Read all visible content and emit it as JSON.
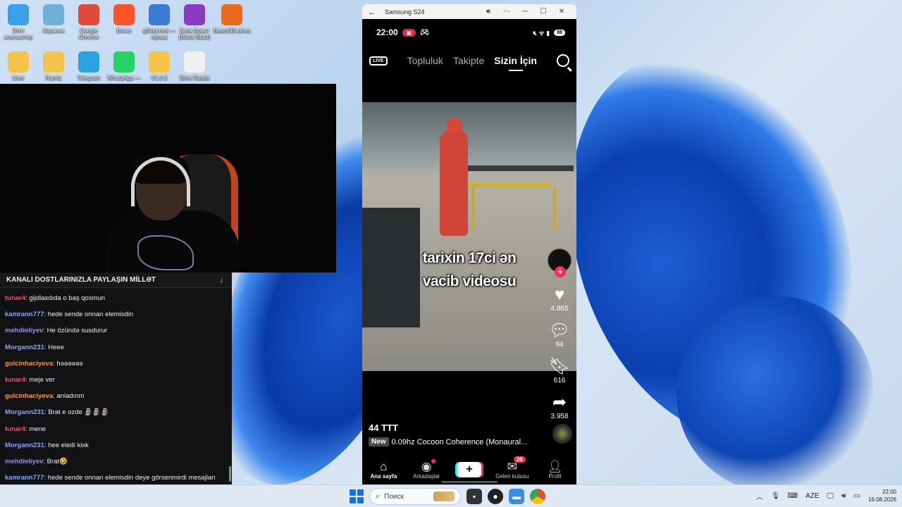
{
  "desktop_icons": [
    {
      "label": "Этот компьютер",
      "icon": "monitor-icon",
      "color": "#3aa0e8"
    },
    {
      "label": "Корзина",
      "icon": "recycle-bin-icon",
      "color": "#6fb0d8"
    },
    {
      "label": "Google Chrome",
      "icon": "chrome-icon",
      "color": "#e04a3a"
    },
    {
      "label": "Brave",
      "icon": "brave-icon",
      "color": "#fb542b"
    },
    {
      "label": "qBittorrent — ярлык",
      "icon": "qbittorrent-icon",
      "color": "#3a7bd5"
    },
    {
      "label": "Блок Бласт (Block Blast)",
      "icon": "block-blast-icon",
      "color": "#8a3ac0"
    },
    {
      "label": "BeamNG.drive",
      "icon": "beamng-icon",
      "color": "#e86a1c"
    },
    {
      "label": "User",
      "icon": "folder-icon",
      "color": "#f3c34a"
    },
    {
      "label": "Ramiz",
      "icon": "folder-icon",
      "color": "#f3c34a"
    },
    {
      "label": "Telegram",
      "icon": "telegram-icon",
      "color": "#2aa3e0"
    },
    {
      "label": "WhatsApp —",
      "icon": "whatsapp-icon",
      "color": "#25d366"
    },
    {
      "label": "V1.0.5",
      "icon": "folder-zip-icon",
      "color": "#f3c34a"
    },
    {
      "label": "Slow Roads",
      "icon": "slow-roads-icon",
      "color": "#f0f0f0"
    }
  ],
  "chat": {
    "header": "KANALI DOSTLARINIZLA PAYLAŞIN MİLLƏT",
    "messages": [
      {
        "user": "tunar4",
        "color": "#ff4d6d",
        "text": ": gijdlaxdıda o baş qosmun"
      },
      {
        "user": "kamrann777",
        "color": "#8aa8ff",
        "text": ": hede sende onnan elemisdin"
      },
      {
        "user": "mehdieliyev",
        "color": "#9b8cff",
        "text": ": He özündə susdurur"
      },
      {
        "user": "Morgann231",
        "color": "#8aa8ff",
        "text": ": Heee"
      },
      {
        "user": "gulcinhaciyeva",
        "color": "#ff9a3c",
        "text": ": həəəəəə"
      },
      {
        "user": "tunar4",
        "color": "#ff4d6d",
        "text": ": meje ver"
      },
      {
        "user": "gulcinhaciyeva",
        "color": "#ff9a3c",
        "text": ": anladınm"
      },
      {
        "user": "Morgann231",
        "color": "#8aa8ff",
        "text": ": Brat e ozde 🗿🗿🗿"
      },
      {
        "user": "tunar4",
        "color": "#ff4d6d",
        "text": ": mene"
      },
      {
        "user": "Morgann231",
        "color": "#8aa8ff",
        "text": ": hee eledi kixk"
      },
      {
        "user": "mehdieliyev",
        "color": "#9b8cff",
        "text": ": Brat🤣"
      },
      {
        "user": "kamrann777",
        "color": "#8aa8ff",
        "text": ": hede sende onnan elemisdin deye görsenmirdi mesajları"
      }
    ]
  },
  "phone": {
    "window_title": "Samsung S24",
    "status": {
      "time": "22:00",
      "battery": "88"
    },
    "nav": {
      "live": "LIVE",
      "tabs": [
        "Topluluk",
        "Takipte",
        "Sizin İçin"
      ],
      "active_tab": 2
    },
    "video": {
      "caption_line1": "tarixin 17ci ən",
      "caption_line2": "vacib videosu",
      "likes": "4.865",
      "comments": "94",
      "saves": "616",
      "shares": "3.958",
      "author": "44 TTT",
      "new_label": "New",
      "song": "0.09hz Cocoon Coherence (Monaural..."
    },
    "bottom_nav": {
      "home": "Ana sayfa",
      "friends": "Arkadaşlar",
      "inbox": "Gelen kutusu",
      "inbox_badge": "26",
      "profile": "Profil"
    }
  },
  "taskbar": {
    "search_placeholder": "Поиск",
    "lang": "AZE",
    "time": "22:00",
    "date": "16.08.2026"
  }
}
